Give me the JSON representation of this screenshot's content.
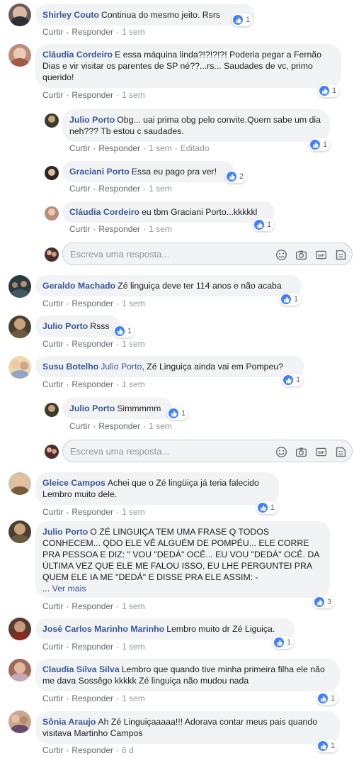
{
  "colors": {
    "link": "#385898",
    "bubble": "#f2f3f5",
    "like": "#4080ff",
    "meta": "#606770"
  },
  "labels": {
    "like": "Curtir",
    "reply": "Responder",
    "see_more": "Ver mais",
    "edited": "Editado"
  },
  "reply_placeholder": "Escreva uma resposta...",
  "comments": [
    {
      "author": "Shirley Couto",
      "text": "Continua do mesmo jeito. Rsrs",
      "time": "1 sem",
      "reactions": "1"
    },
    {
      "author": "Cláudia Cordeiro",
      "text": "E essa máquina linda?!?!?!?! Poderia pegar a Fernão Dias e vir visitar os parentes de SP né??...rs... Saudades de vc, primo querido!",
      "time": "1 sem",
      "reactions": "1",
      "replies": [
        {
          "author": "Julio Porto",
          "text": "Obg... uai prima obg pelo convite.Quem sabe um dia neh??? Tb estou c saudades.",
          "time": "1 sem",
          "reactions": "1"
        },
        {
          "author": "Graciani Porto",
          "text": "Essa eu pago pra ver!",
          "time": "1 sem",
          "reactions": "2"
        },
        {
          "author": "Cláudia Cordeiro",
          "text": "eu tbm Graciani Porto...kkkkkl",
          "time": "1 sem",
          "reactions": "1"
        }
      ]
    },
    {
      "author": "Geraldo Machado",
      "text": "Zé linguiça deve ter 114 anos e não acaba",
      "time": "1 sem",
      "reactions": "1"
    },
    {
      "author": "Julio Porto",
      "text": "Rsss",
      "time": "1 sem",
      "reactions": "1"
    },
    {
      "author": "Susu Botelho",
      "mention": "Julio Porto",
      "text": ", Zé Linguiça ainda vai em Pompeu?",
      "time": "1 sem",
      "reactions": "1",
      "replies": [
        {
          "author": "Julio Porto",
          "text": "Simmmmm",
          "time": "1 sem",
          "reactions": "1"
        }
      ]
    },
    {
      "author": "Gleice Campos",
      "text": "Achei que o Zé lingüiça já teria falecido Lembro muito dele.",
      "time": "1 sem",
      "reactions": "1"
    },
    {
      "author": "Julio Porto",
      "text": "O ZÉ LINGUIÇA TEM UMA FRASE Q TODOS CONHECEM... QDO ELE VÊ ALGUÉM DE POMPÉU... ELE CORRE PRA PESSOA E DIZ: \" VOU \"DEDÁ\" OCÊ... EU VOU \"DEDÁ\" OCÊ. DA ÚLTIMA VEZ QUE ELE ME FALOU ISSO, EU LHE PERGUNTEI PRA QUEM ELE IA ME \"DEDÁ\" E DISSE PRA ELE ASSIM: -",
      "ellipsis": "...",
      "time": "1 sem",
      "reactions": "3"
    },
    {
      "author": "José Carlos Marinho Marinho",
      "text": "Lembro muito dr Zé Liguiça.",
      "time": "1 sem",
      "reactions": "1"
    },
    {
      "author": "Claudia Silva Silva",
      "text": "Lembro que quando tive minha primeira filha ele não me dava Sossêgo kkkkk Zé linguiça não mudou nada",
      "time": "1 sem",
      "reactions": "1"
    },
    {
      "author": "Sônia Araujo",
      "text": "Ah Zé Linguiçaaaaa!!! Adorava contar meus pais quando visitava Martinho Campos",
      "time": "6 d",
      "reactions": "1"
    }
  ]
}
